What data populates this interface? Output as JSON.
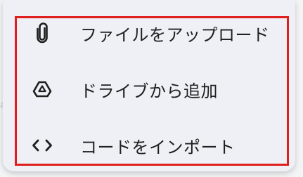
{
  "menu": {
    "items": [
      {
        "label": "ファイルをアップロード",
        "icon": "paperclip-icon"
      },
      {
        "label": "ドライブから追加",
        "icon": "drive-icon"
      },
      {
        "label": "コードをインポート",
        "icon": "code-icon"
      }
    ]
  },
  "colors": {
    "highlight": "#e01e1e",
    "menu_bg": "#eef0f5",
    "text": "#1f1f1f"
  }
}
